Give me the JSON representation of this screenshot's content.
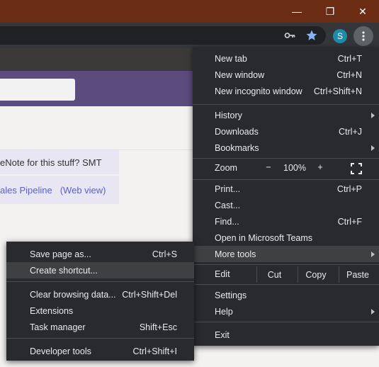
{
  "window_controls": {
    "minimize": "—",
    "restore": "❐",
    "close": "✕"
  },
  "toolbar": {
    "key_icon": "key-icon",
    "bookmark_icon": "star-icon",
    "avatar_letter": "S",
    "menu_icon": "kebab-icon",
    "colors": {
      "star": "#8ab4f8",
      "avatar": "#1e8ba8"
    }
  },
  "page": {
    "row1_text": "eNote for this stuff? SMT",
    "row2_link1": "ales Pipeline",
    "row2_link2": "(Web view)"
  },
  "main_menu": {
    "new_tab": {
      "label": "New tab",
      "shortcut": "Ctrl+T"
    },
    "new_window": {
      "label": "New window",
      "shortcut": "Ctrl+N"
    },
    "new_incognito": {
      "label": "New incognito window",
      "shortcut": "Ctrl+Shift+N"
    },
    "history": {
      "label": "History"
    },
    "downloads": {
      "label": "Downloads",
      "shortcut": "Ctrl+J"
    },
    "bookmarks": {
      "label": "Bookmarks"
    },
    "zoom": {
      "label": "Zoom",
      "minus": "−",
      "value": "100%",
      "plus": "+"
    },
    "print": {
      "label": "Print...",
      "shortcut": "Ctrl+P"
    },
    "cast": {
      "label": "Cast..."
    },
    "find": {
      "label": "Find...",
      "shortcut": "Ctrl+F"
    },
    "open_teams": {
      "label": "Open in Microsoft Teams"
    },
    "more_tools": {
      "label": "More tools"
    },
    "edit": {
      "label": "Edit",
      "cut": "Cut",
      "copy": "Copy",
      "paste": "Paste"
    },
    "settings": {
      "label": "Settings"
    },
    "help": {
      "label": "Help"
    },
    "exit": {
      "label": "Exit"
    }
  },
  "sub_menu": {
    "save_page": {
      "label": "Save page as...",
      "shortcut": "Ctrl+S"
    },
    "create_shortcut": {
      "label": "Create shortcut..."
    },
    "clear_browsing": {
      "label": "Clear browsing data...",
      "shortcut": "Ctrl+Shift+Del"
    },
    "extensions": {
      "label": "Extensions"
    },
    "task_manager": {
      "label": "Task manager",
      "shortcut": "Shift+Esc"
    },
    "developer_tools": {
      "label": "Developer tools",
      "shortcut": "Ctrl+Shift+I"
    }
  }
}
